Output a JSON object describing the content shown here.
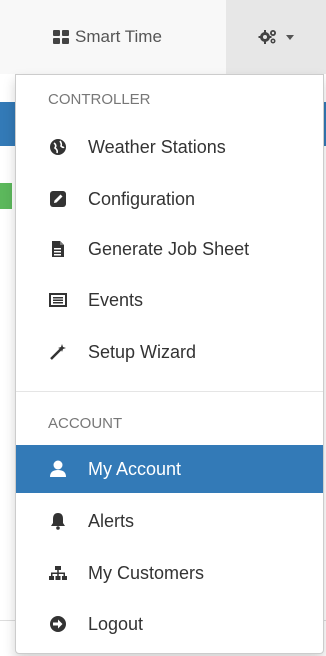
{
  "navbar": {
    "brand_label": "Smart Time",
    "brand_icon": "th-large-icon",
    "settings_icon": "gears-icon"
  },
  "menu": {
    "controller_header": "CONTROLLER",
    "account_header": "ACCOUNT",
    "controller_items": [
      {
        "label": "Weather Stations",
        "icon": "globe-icon"
      },
      {
        "label": "Configuration",
        "icon": "edit-icon"
      },
      {
        "label": "Generate Job Sheet",
        "icon": "file-icon"
      },
      {
        "label": "Events",
        "icon": "list-icon"
      },
      {
        "label": "Setup Wizard",
        "icon": "magic-wand-icon"
      }
    ],
    "account_items": [
      {
        "label": "My Account",
        "icon": "user-icon",
        "active": true
      },
      {
        "label": "Alerts",
        "icon": "bell-icon"
      },
      {
        "label": "My Customers",
        "icon": "sitemap-icon"
      },
      {
        "label": "Logout",
        "icon": "circle-arrow-right-icon"
      }
    ]
  },
  "colors": {
    "active_bg": "#337ab7",
    "navbar_bg": "#f8f8f8",
    "text": "#333333",
    "header_text": "#777777"
  }
}
